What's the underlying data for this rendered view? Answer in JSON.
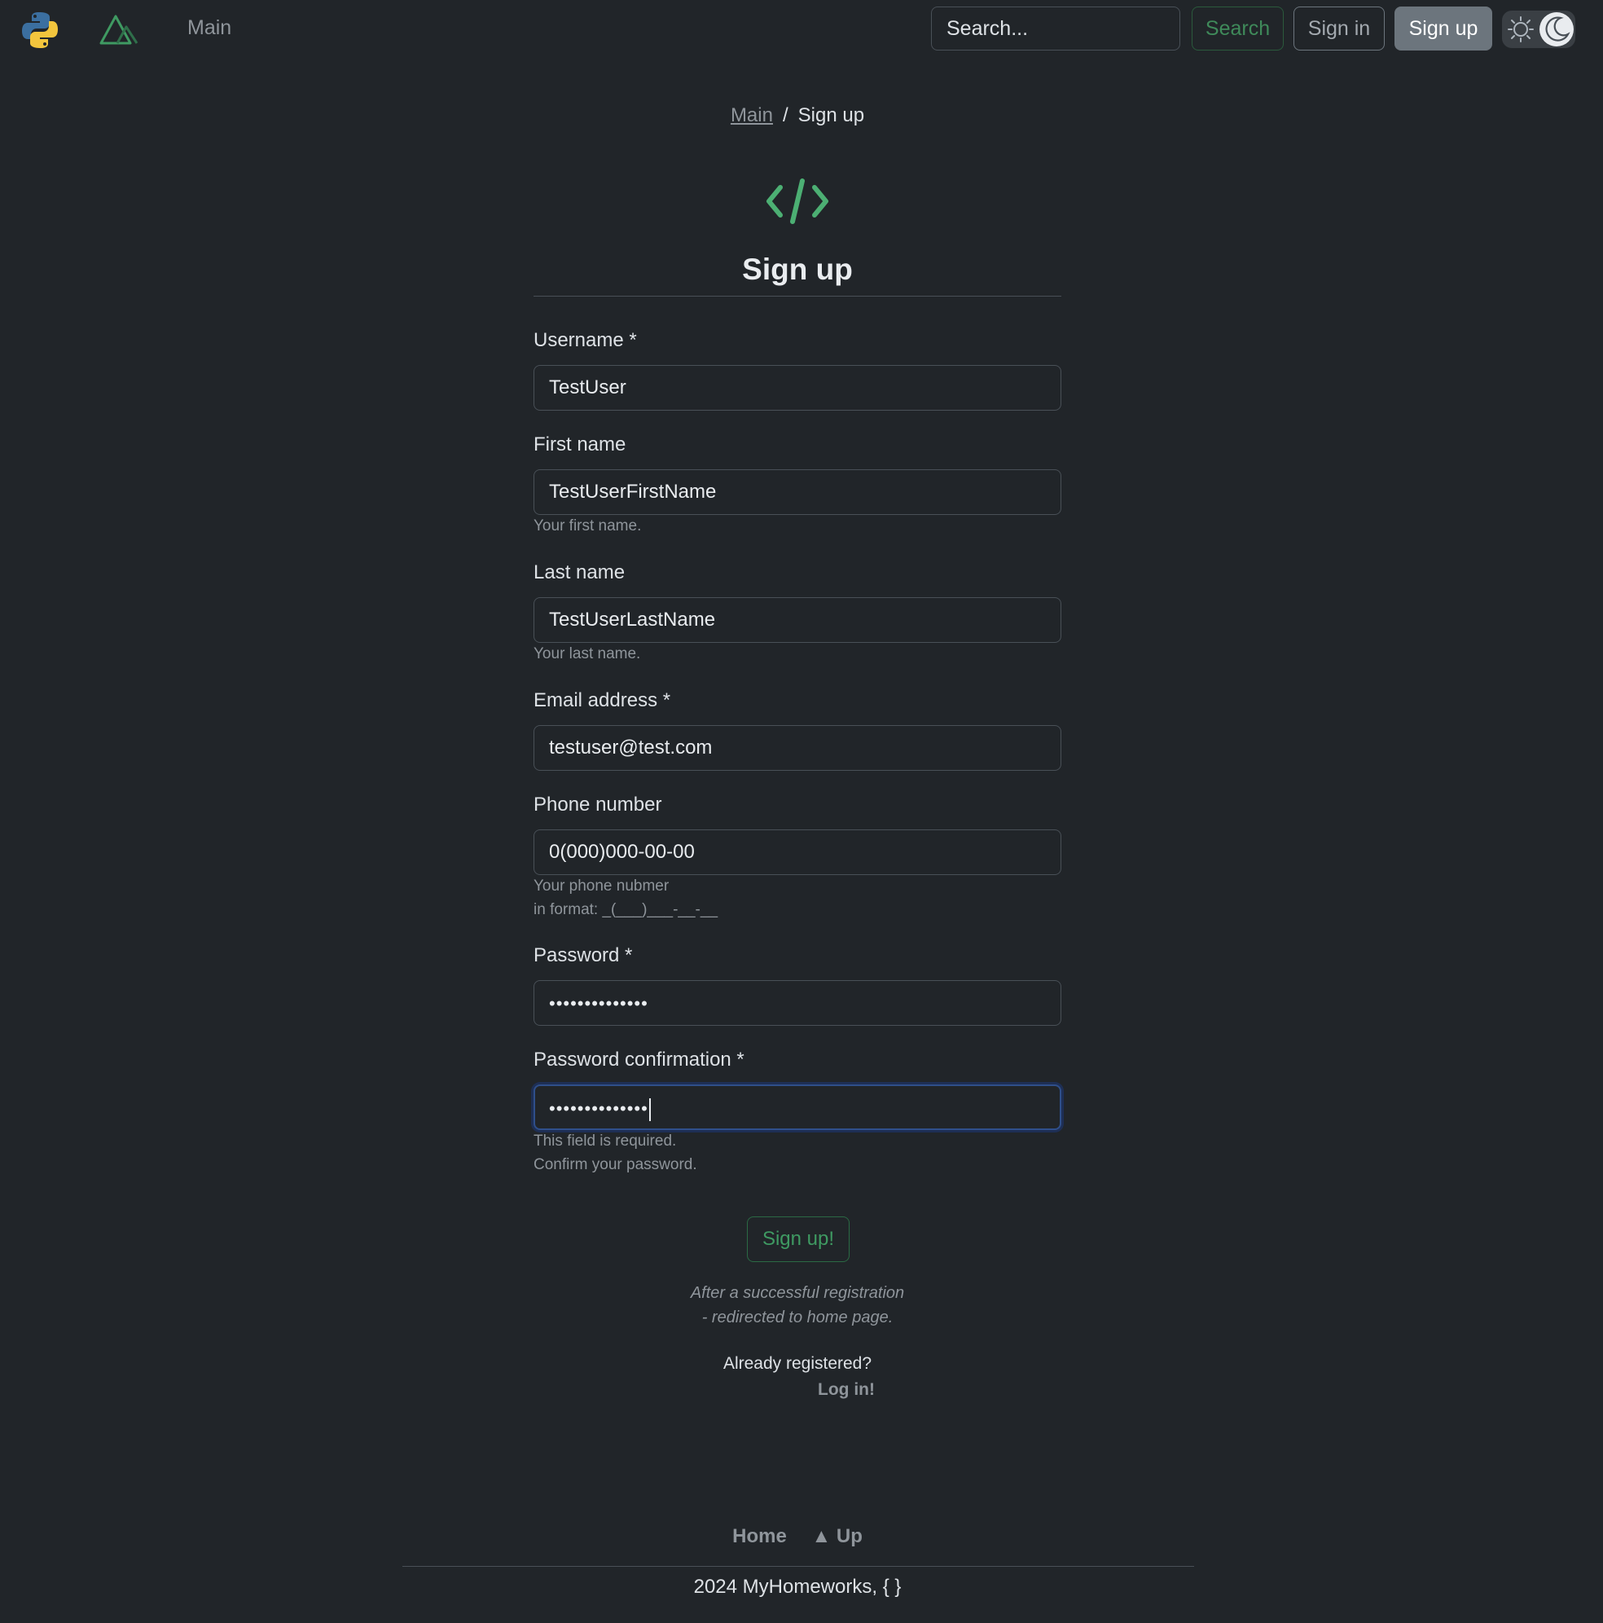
{
  "navbar": {
    "python_logo_icon": "python-logo-icon",
    "mountain_logo_icon": "mountain-logo-icon",
    "main_link": "Main",
    "search_placeholder": "Search...",
    "search_button": "Search",
    "signin_button": "Sign in",
    "signup_button": "Sign up",
    "theme_toggle_icons": [
      "sun-icon",
      "moon-icon"
    ]
  },
  "breadcrumb": {
    "items": [
      {
        "label": "Main"
      },
      {
        "label": "Sign up"
      }
    ],
    "separator": "/"
  },
  "page": {
    "icon": "code-icon",
    "title": "Sign up"
  },
  "form": {
    "fields": [
      {
        "label": "Username *",
        "value": "TestUser",
        "help": ""
      },
      {
        "label": "First name",
        "value": "TestUserFirstName",
        "help": "Your first name."
      },
      {
        "label": "Last name",
        "value": "TestUserLastName",
        "help": "Your last name."
      },
      {
        "label": "Email address *",
        "value": "testuser@test.com",
        "help": ""
      },
      {
        "label": "Phone number",
        "value": "0(000)000-00-00",
        "help_lines": [
          "Your phone nubmer",
          "in format: _(___)___-__-__"
        ]
      },
      {
        "label": "Password *",
        "value": "••••••••••••••",
        "help": ""
      },
      {
        "label": "Password confirmation *",
        "value": "••••••••••••••",
        "help_lines": [
          "This field is required.",
          "Confirm your password."
        ]
      }
    ],
    "submit_label": "Sign up!",
    "note_lines": [
      "After a successful registration",
      "- redirected to home page."
    ],
    "already_registered": "Already registered?",
    "login_link": "Log in!"
  },
  "footer": {
    "links": [
      "Home",
      "▲ Up"
    ],
    "copyright": "2024 MyHomeworks, { }"
  },
  "colors": {
    "background": "#212529",
    "accent_green": "#4caf73",
    "muted": "#8f959b"
  }
}
